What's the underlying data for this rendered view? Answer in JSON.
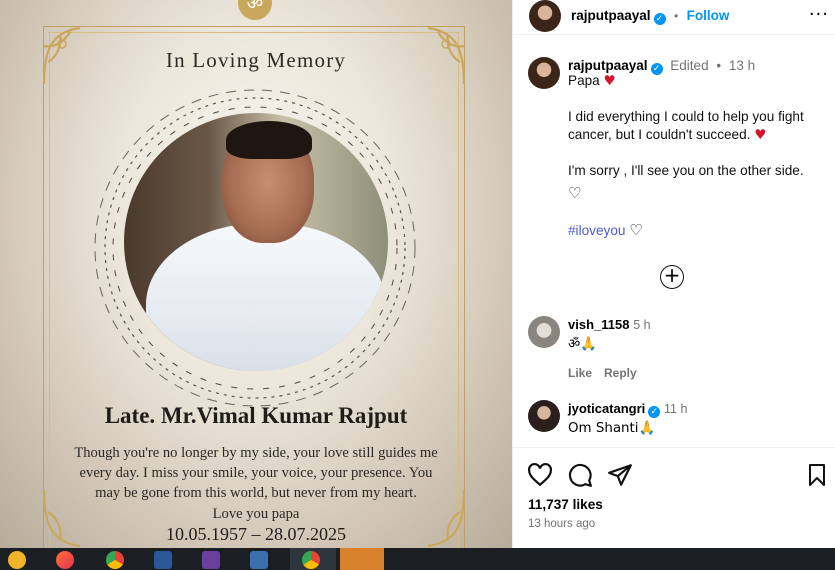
{
  "memorial": {
    "om_symbol": "ॐ",
    "heading": "In Loving Memory",
    "name": "Late. Mr.Vimal Kumar Rajput",
    "message_lines": [
      "Though you're no longer by my side, your love still guides me",
      "every day. I miss your smile, your voice, your presence. You",
      "may be gone from this world, but never from my heart.",
      "Love you papa"
    ],
    "dates": "10.05.1957 – 28.07.2025"
  },
  "post_header": {
    "username": "rajputpaayal",
    "separator": "•",
    "follow_label": "Follow",
    "more_label": "···"
  },
  "caption": {
    "username": "rajputpaayal",
    "edited_label": "Edited",
    "separator": "•",
    "time": "13 h",
    "line1": "Papa",
    "line2": "I did everything I could to help you fight cancer, but I couldn't succeed.",
    "line3": "I'm sorry , I'll see you on the other side.",
    "hashtag": "#iloveyou",
    "heart_red": "♥",
    "heart_outline": "♡"
  },
  "load_more_label": "+",
  "comments": [
    {
      "username": "vish_1158",
      "time": "5 h",
      "text": "ॐ🙏",
      "like_label": "Like",
      "reply_label": "Reply"
    },
    {
      "username": "jyoticatangri",
      "time": "11 h",
      "text": "Om Shanti🙏"
    }
  ],
  "footer": {
    "likes": "11,737 likes",
    "time_ago": "13 hours ago"
  },
  "icons": [
    "heart-icon",
    "comment-icon",
    "share-icon",
    "bookmark-icon",
    "verified-badge-icon",
    "more-options-icon",
    "add-circle-icon"
  ],
  "colors": {
    "accent_blue": "#0095f6",
    "gold": "#c9a85e",
    "muted_text": "#737373",
    "taskbar": "#1b1f24"
  }
}
